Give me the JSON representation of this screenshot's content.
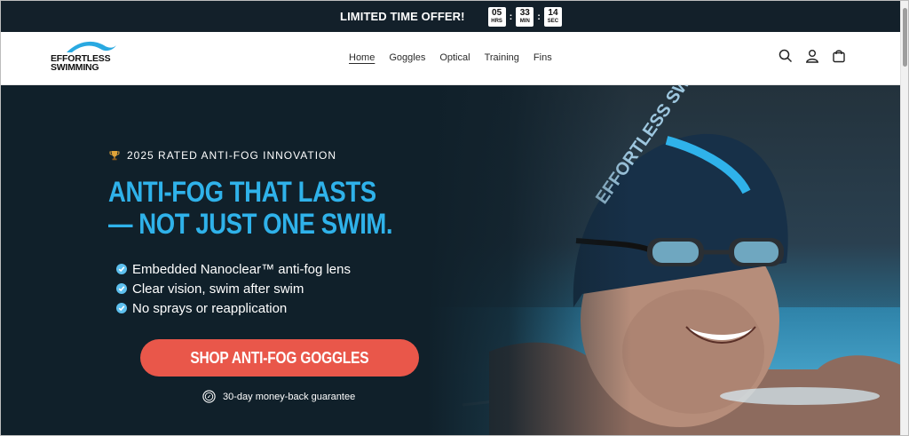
{
  "announcement": {
    "offer_text": "LIMITED TIME OFFER!",
    "timer": {
      "hours": "05",
      "hours_label": "HRS",
      "minutes": "33",
      "minutes_label": "MIN",
      "seconds": "14",
      "seconds_label": "SEC",
      "separator": ":"
    }
  },
  "header": {
    "logo": {
      "line1": "EFFORTLESS",
      "line2": "SWIMMING"
    },
    "nav": [
      "Home",
      "Goggles",
      "Optical",
      "Training",
      "Fins"
    ],
    "active_nav": "Home",
    "icons": [
      "search-icon",
      "account-icon",
      "cart-icon"
    ]
  },
  "hero": {
    "eyebrow": "2025 RATED ANTI-FOG INNOVATION",
    "headline": "ANTI-FOG THAT LASTS — NOT JUST ONE SWIM.",
    "features": [
      "Embedded Nanoclear™ anti-fog lens",
      "Clear vision, swim after swim",
      "No sprays or reapplication"
    ],
    "cta_label": "SHOP ANTI-FOG GOGGLES",
    "guarantee": "30-day money-back guarantee",
    "cap_text": "EFFORTLESS SWIMMING"
  },
  "colors": {
    "dark_bg": "#10202a",
    "accent_blue": "#2fb2ea",
    "cta_red": "#e9574a",
    "check_blue": "#5ec1ef"
  }
}
